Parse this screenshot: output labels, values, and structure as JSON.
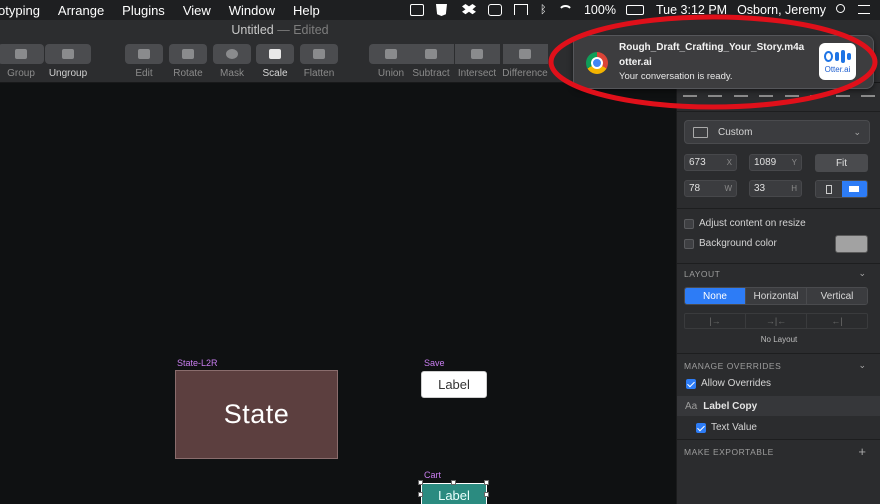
{
  "menubar": {
    "items": [
      "otyping",
      "Arrange",
      "Plugins",
      "View",
      "Window",
      "Help"
    ],
    "battery": "100%",
    "clock": "Tue 3:12 PM",
    "user": "Osborn, Jeremy"
  },
  "window": {
    "title": "Untitled",
    "edited": "— Edited"
  },
  "toolbar": {
    "group": "Group",
    "ungroup": "Ungroup",
    "edit": "Edit",
    "rotate": "Rotate",
    "mask": "Mask",
    "scale": "Scale",
    "flatten": "Flatten",
    "union": "Union",
    "subtract": "Subtract",
    "intersect": "Intersect",
    "difference": "Difference"
  },
  "canvas": {
    "state_board": {
      "name": "State-L2R",
      "text": "State",
      "color": "#5c3f3f"
    },
    "save_board": {
      "name": "Save",
      "text": "Label"
    },
    "cart_board": {
      "name": "Cart",
      "text": "Label",
      "color": "#2b8b80"
    },
    "artboard_label_color": "#c97ef0"
  },
  "inspector": {
    "preset": "Custom",
    "x": "673",
    "x_unit": "X",
    "y": "1089",
    "y_unit": "Y",
    "w": "78",
    "w_unit": "W",
    "h": "33",
    "h_unit": "H",
    "fit": "Fit",
    "adjust_content": "Adjust content on resize",
    "adjust_content_checked": false,
    "background_color": "Background color",
    "background_color_checked": false,
    "layout_header": "LAYOUT",
    "layout_options": [
      "None",
      "Horizontal",
      "Vertical"
    ],
    "layout_selected": "None",
    "no_layout": "No Layout",
    "overrides_header": "MANAGE OVERRIDES",
    "allow_overrides": "Allow Overrides",
    "allow_overrides_checked": true,
    "override_layer": "Label Copy",
    "override_layer_prefix": "Aa",
    "text_value": "Text Value",
    "text_value_checked": true,
    "exportable_header": "MAKE EXPORTABLE",
    "accent": "#2d7cf6"
  },
  "notification": {
    "title": "Rough_Draft_Crafting_Your_Story.m4a",
    "app": "otter.ai",
    "body": "Your conversation is ready.",
    "app_icon_text": "Otter.ai"
  },
  "annotation": {
    "color": "#e0101a"
  }
}
